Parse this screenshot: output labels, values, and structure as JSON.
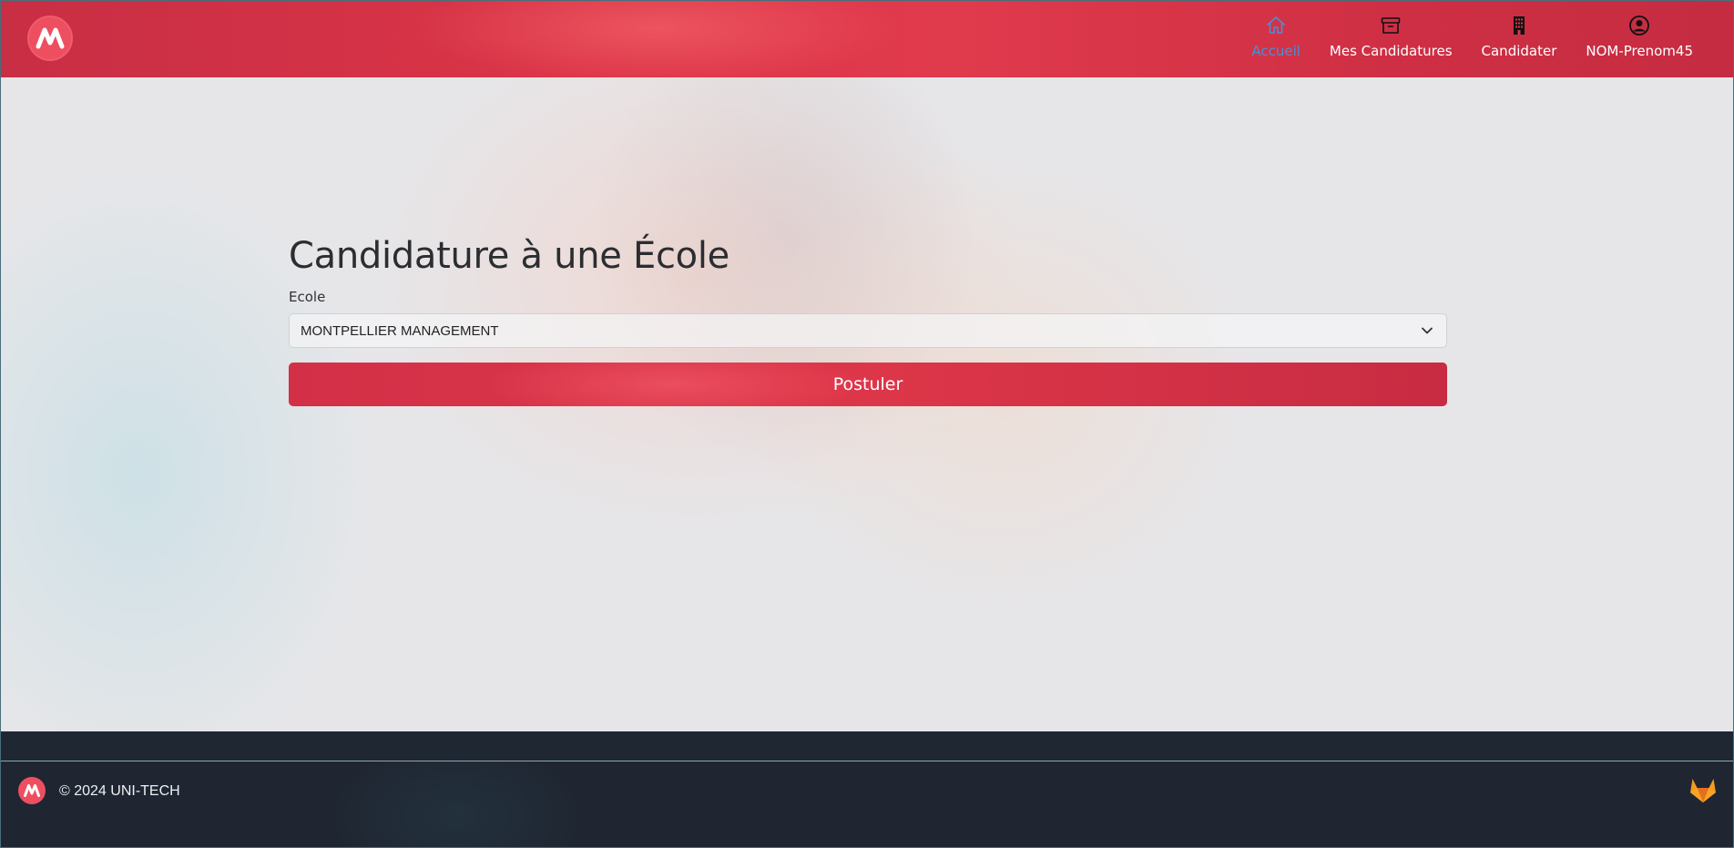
{
  "header": {
    "logo_icon": "uni-tech-logo-icon",
    "nav": [
      {
        "label": "Accueil",
        "icon": "home-icon",
        "active": true
      },
      {
        "label": "Mes Candidatures",
        "icon": "archive-icon",
        "active": false
      },
      {
        "label": "Candidater",
        "icon": "building-icon",
        "active": false
      },
      {
        "label": "NOM-Prenom45",
        "icon": "user-circle-icon",
        "active": false
      }
    ]
  },
  "form": {
    "title": "Candidature à une École",
    "school_label": "Ecole",
    "school_selected": "MONTPELLIER MANAGEMENT",
    "submit_label": "Postuler"
  },
  "footer": {
    "copyright": "© 2024 UNI-TECH",
    "right_icon": "gitlab-icon"
  },
  "colors": {
    "brand_red": "#dc3548",
    "active_link": "#4a8fd6",
    "footer_bg": "#1f2632",
    "gitlab_orange": "#f39c1f"
  }
}
